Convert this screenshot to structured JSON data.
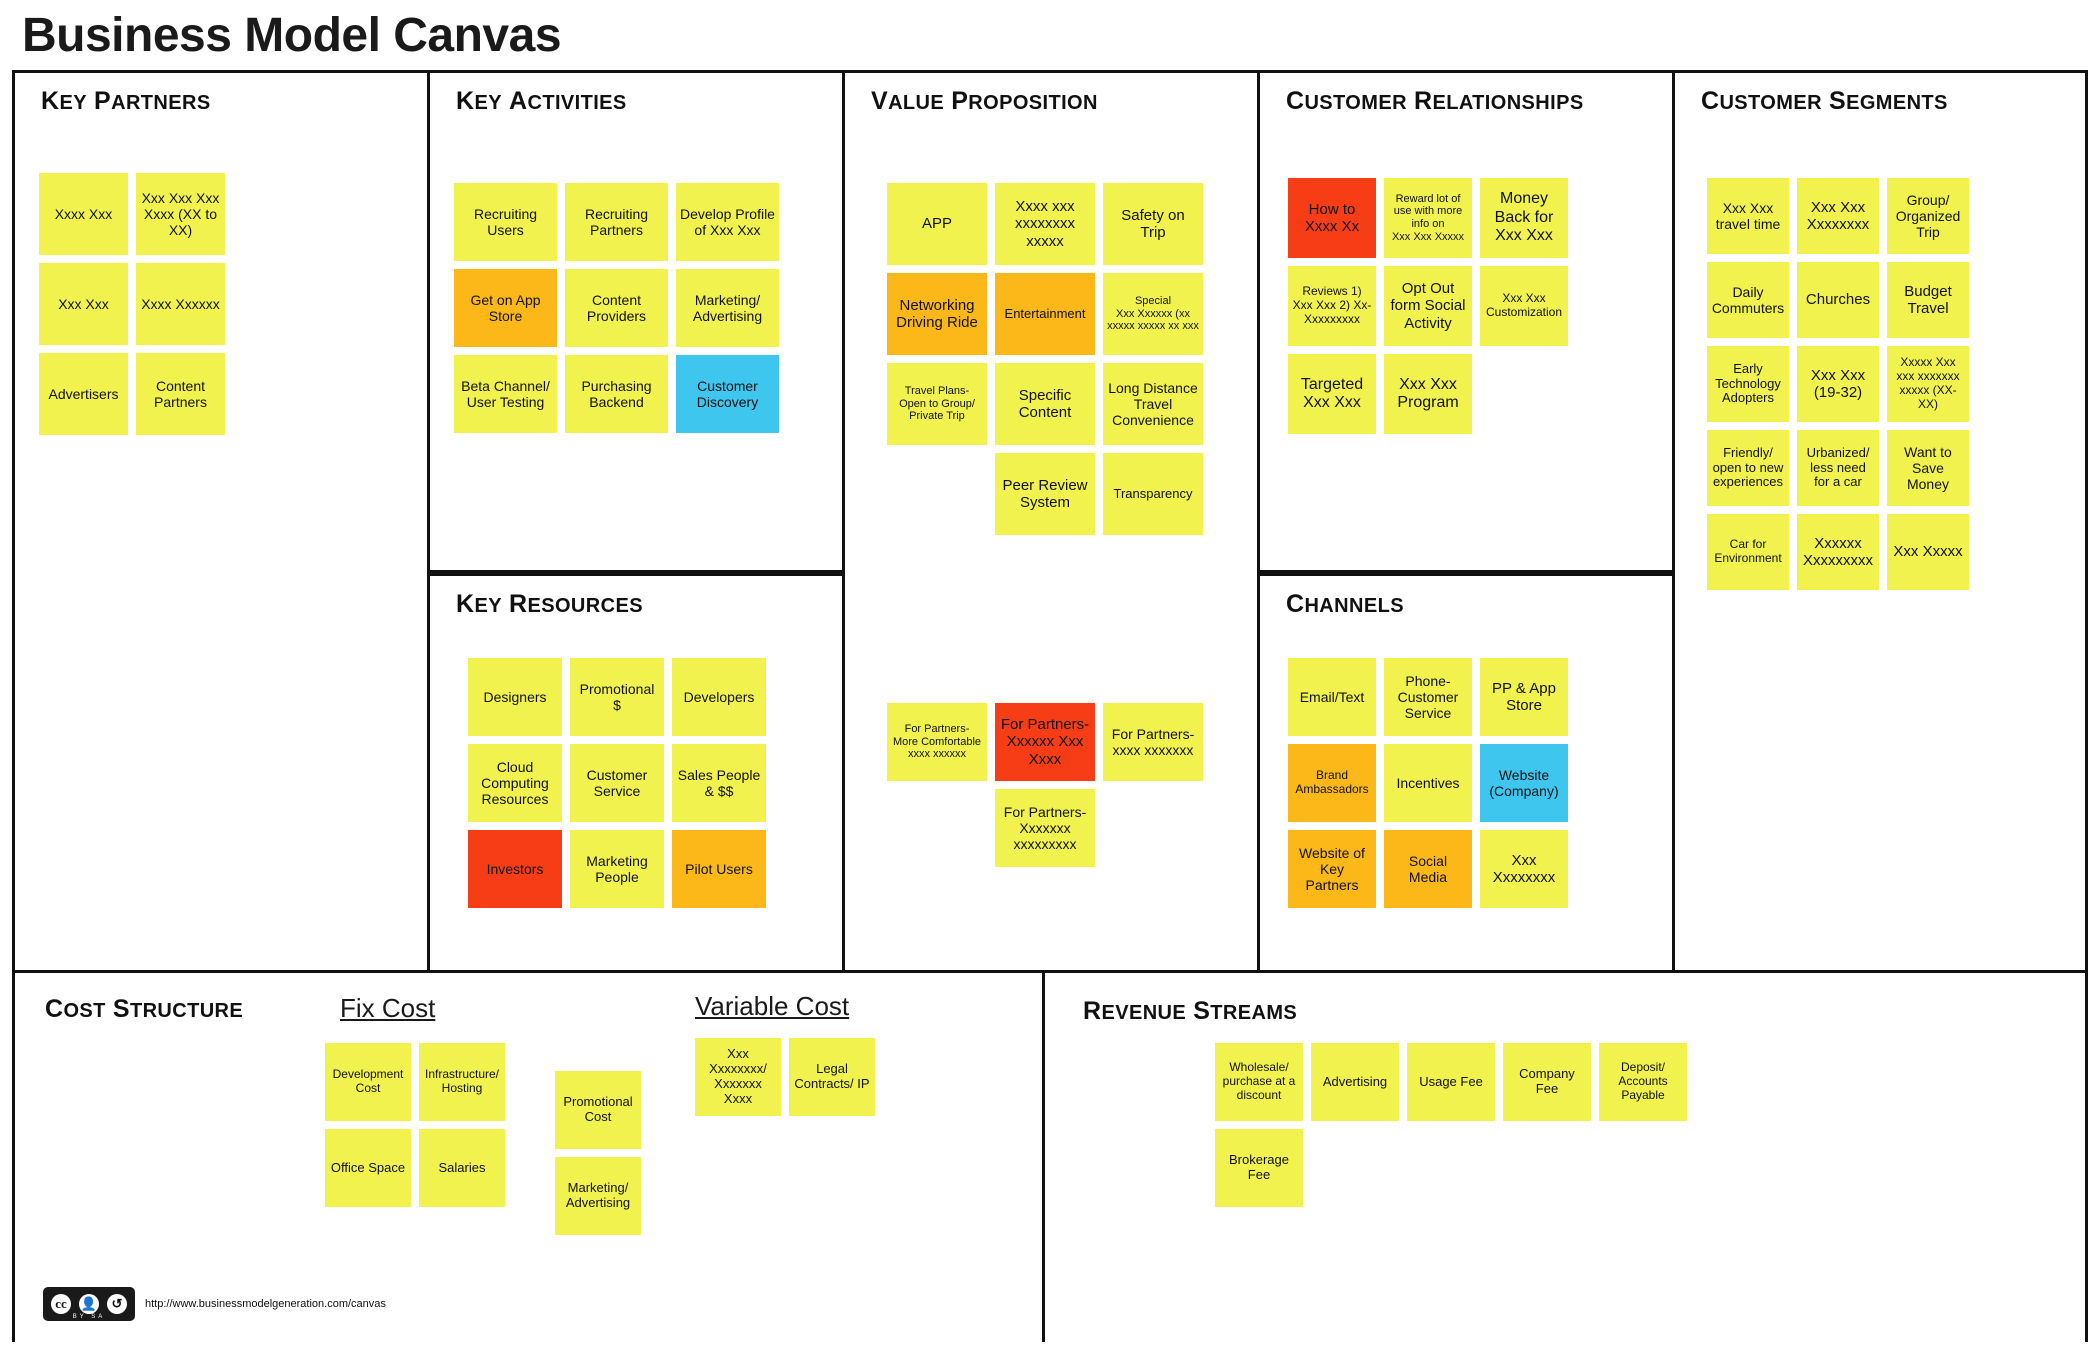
{
  "title": "Business Model Canvas",
  "footer": {
    "license_badge": [
      "CC",
      "BY",
      "SA"
    ],
    "url": "http://www.businessmodelgeneration.com/canvas"
  },
  "blocks": {
    "key_partners": {
      "title": "Key Partners",
      "notes": [
        {
          "text": "Xxxx Xxx",
          "color": "yellow",
          "size": "s"
        },
        {
          "text": "Xxx Xxx Xxx Xxxx (XX to XX)",
          "color": "yellow",
          "size": "s"
        },
        {
          "text": "Xxx Xxx",
          "color": "yellow",
          "size": "s"
        },
        {
          "text": "Xxxx Xxxxxx",
          "color": "yellow",
          "size": "s"
        },
        {
          "text": "Advertisers",
          "color": "yellow",
          "size": "s"
        },
        {
          "text": "Content Partners",
          "color": "yellow",
          "size": "s"
        }
      ]
    },
    "key_activities": {
      "title": "Key Activities",
      "notes": [
        {
          "text": "Recruiting Users",
          "color": "yellow"
        },
        {
          "text": "Recruiting Partners",
          "color": "yellow"
        },
        {
          "text": "Develop Profile of Xxx Xxx",
          "color": "yellow"
        },
        {
          "text": "Get on App Store",
          "color": "orange"
        },
        {
          "text": "Content Providers",
          "color": "yellow"
        },
        {
          "text": "Marketing/ Advertising",
          "color": "yellow"
        },
        {
          "text": "Beta Channel/ User Testing",
          "color": "yellow"
        },
        {
          "text": "Purchasing Backend",
          "color": "yellow"
        },
        {
          "text": "Customer Discovery",
          "color": "cyan"
        }
      ]
    },
    "key_resources": {
      "title": "Key Resources",
      "notes": [
        {
          "text": "Designers",
          "color": "yellow"
        },
        {
          "text": "Promotional $",
          "color": "yellow"
        },
        {
          "text": "Developers",
          "color": "yellow"
        },
        {
          "text": "Cloud Computing Resources",
          "color": "yellow"
        },
        {
          "text": "Customer Service",
          "color": "yellow"
        },
        {
          "text": "Sales People & $$",
          "color": "yellow"
        },
        {
          "text": "Investors",
          "color": "red"
        },
        {
          "text": "Marketing People",
          "color": "yellow"
        },
        {
          "text": "Pilot Users",
          "color": "orange"
        }
      ]
    },
    "value_proposition": {
      "title": "Value Proposition",
      "notes_top": [
        {
          "text": "APP",
          "color": "yellow",
          "fs": 15
        },
        {
          "text": "Xxxx xxx xxxxxxxx xxxxx",
          "color": "yellow",
          "fs": 15
        },
        {
          "text": "Safety on Trip",
          "color": "yellow",
          "fs": 15
        },
        {
          "text": "Networking Driving Ride",
          "color": "orange",
          "fs": 15
        },
        {
          "text": "Entertainment",
          "color": "orange",
          "fs": 13
        },
        {
          "text": "Special\nXxx Xxxxxx (xx xxxxx xxxxx xx xxx",
          "color": "yellow",
          "fs": 11
        },
        {
          "text": "Travel Plans- Open to Group/ Private Trip",
          "color": "yellow",
          "fs": 11
        },
        {
          "text": "Specific Content",
          "color": "yellow",
          "fs": 15
        },
        {
          "text": "Long Distance Travel Convenience",
          "color": "yellow",
          "fs": 14
        },
        {
          "text": "",
          "color": "none",
          "fs": 12
        },
        {
          "text": "Peer Review System",
          "color": "yellow",
          "fs": 15
        },
        {
          "text": "Transparency",
          "color": "yellow",
          "fs": 13
        }
      ],
      "notes_bottom": [
        {
          "text": "For Partners- More Comfortable\nxxxx xxxxxx",
          "color": "yellow",
          "fs": 11
        },
        {
          "text": "For Partners- Xxxxxx Xxx Xxxx",
          "color": "red",
          "fs": 15
        },
        {
          "text": "For Partners- xxxx xxxxxxx",
          "color": "yellow",
          "fs": 14
        },
        {
          "text": "",
          "color": "none",
          "fs": 12
        },
        {
          "text": "For Partners- Xxxxxxx xxxxxxxxx",
          "color": "yellow",
          "fs": 14
        },
        {
          "text": "",
          "color": "none",
          "fs": 12
        }
      ]
    },
    "customer_relationships": {
      "title": "Customer Relationships",
      "notes": [
        {
          "text": "How to Xxxx Xx",
          "color": "red",
          "fs": 15
        },
        {
          "text": "Reward lot of use with more info on\nXxx Xxx Xxxxx",
          "color": "yellow",
          "fs": 11
        },
        {
          "text": "Money Back for Xxx Xxx",
          "color": "yellow",
          "fs": 16
        },
        {
          "text": "Reviews 1) Xxx Xxx 2) Xx-Xxxxxxxxx",
          "color": "yellow",
          "fs": 12
        },
        {
          "text": "Opt Out form Social Activity",
          "color": "yellow",
          "fs": 15
        },
        {
          "text": "Xxx Xxx Customization",
          "color": "yellow",
          "fs": 12
        },
        {
          "text": "Targeted Xxx Xxx",
          "color": "yellow",
          "fs": 16
        },
        {
          "text": "Xxx Xxx Program",
          "color": "yellow",
          "fs": 16
        }
      ]
    },
    "channels": {
      "title": "Channels",
      "notes": [
        {
          "text": "Email/Text",
          "color": "yellow",
          "fs": 14
        },
        {
          "text": "Phone- Customer Service",
          "color": "yellow",
          "fs": 14
        },
        {
          "text": "PP & App Store",
          "color": "yellow",
          "fs": 15
        },
        {
          "text": "Brand Ambassadors",
          "color": "orange",
          "fs": 12
        },
        {
          "text": "Incentives",
          "color": "yellow",
          "fs": 14
        },
        {
          "text": "Website (Company)",
          "color": "cyan",
          "fs": 14
        },
        {
          "text": "Website of Key Partners",
          "color": "orange",
          "fs": 14
        },
        {
          "text": "Social Media",
          "color": "orange",
          "fs": 14
        },
        {
          "text": "Xxx Xxxxxxxx",
          "color": "yellow",
          "fs": 15
        }
      ]
    },
    "customer_segments": {
      "title": "Customer Segments",
      "notes": [
        {
          "text": "Xxx Xxx travel time",
          "color": "yellow",
          "fs": 14
        },
        {
          "text": "Xxx Xxx Xxxxxxxx",
          "color": "yellow",
          "fs": 15
        },
        {
          "text": "Group/ Organized Trip",
          "color": "yellow",
          "fs": 14
        },
        {
          "text": "Daily Commuters",
          "color": "yellow",
          "fs": 14
        },
        {
          "text": "Churches",
          "color": "yellow",
          "fs": 15
        },
        {
          "text": "Budget Travel",
          "color": "yellow",
          "fs": 15
        },
        {
          "text": "Early Technology Adopters",
          "color": "yellow",
          "fs": 13
        },
        {
          "text": "Xxx Xxx (19-32)",
          "color": "yellow",
          "fs": 15
        },
        {
          "text": "Xxxxx Xxx xxx xxxxxxx xxxxx (XX-XX)",
          "color": "yellow",
          "fs": 12
        },
        {
          "text": "Friendly/ open to new experiences",
          "color": "yellow",
          "fs": 13
        },
        {
          "text": "Urbanized/ less need for a car",
          "color": "yellow",
          "fs": 13
        },
        {
          "text": "Want to Save Money",
          "color": "yellow",
          "fs": 14
        },
        {
          "text": "Car for Environment",
          "color": "yellow",
          "fs": 12
        },
        {
          "text": "Xxxxxx Xxxxxxxxx",
          "color": "yellow",
          "fs": 15
        },
        {
          "text": "Xxx Xxxxx",
          "color": "yellow",
          "fs": 15
        }
      ]
    },
    "cost_structure": {
      "title": "Cost Structure",
      "fix_cost_label": "Fix Cost",
      "variable_cost_label": "Variable Cost",
      "fix_cost_notes": [
        {
          "text": "Development Cost",
          "color": "yellow",
          "fs": 12
        },
        {
          "text": "Infrastructure/ Hosting",
          "color": "yellow",
          "fs": 12
        },
        {
          "text": "Office Space",
          "color": "yellow",
          "fs": 13
        },
        {
          "text": "Salaries",
          "color": "yellow",
          "fs": 13
        }
      ],
      "fix_cost_notes_2": [
        {
          "text": "Promotional Cost",
          "color": "yellow",
          "fs": 13
        },
        {
          "text": "Marketing/ Advertising",
          "color": "yellow",
          "fs": 13
        }
      ],
      "variable_cost_notes": [
        {
          "text": "Xxx Xxxxxxxx/ Xxxxxxx Xxxx",
          "color": "yellow",
          "fs": 13
        },
        {
          "text": "Legal Contracts/ IP",
          "color": "yellow",
          "fs": 13
        }
      ]
    },
    "revenue_streams": {
      "title": "Revenue Streams",
      "notes": [
        {
          "text": "Wholesale/ purchase at a discount",
          "color": "yellow",
          "fs": 12
        },
        {
          "text": "Advertising",
          "color": "yellow",
          "fs": 13
        },
        {
          "text": "Usage Fee",
          "color": "yellow",
          "fs": 13
        },
        {
          "text": "Company Fee",
          "color": "yellow",
          "fs": 13
        },
        {
          "text": "Deposit/ Accounts Payable",
          "color": "yellow",
          "fs": 12
        },
        {
          "text": "Brokerage Fee",
          "color": "yellow",
          "fs": 13
        }
      ]
    }
  }
}
